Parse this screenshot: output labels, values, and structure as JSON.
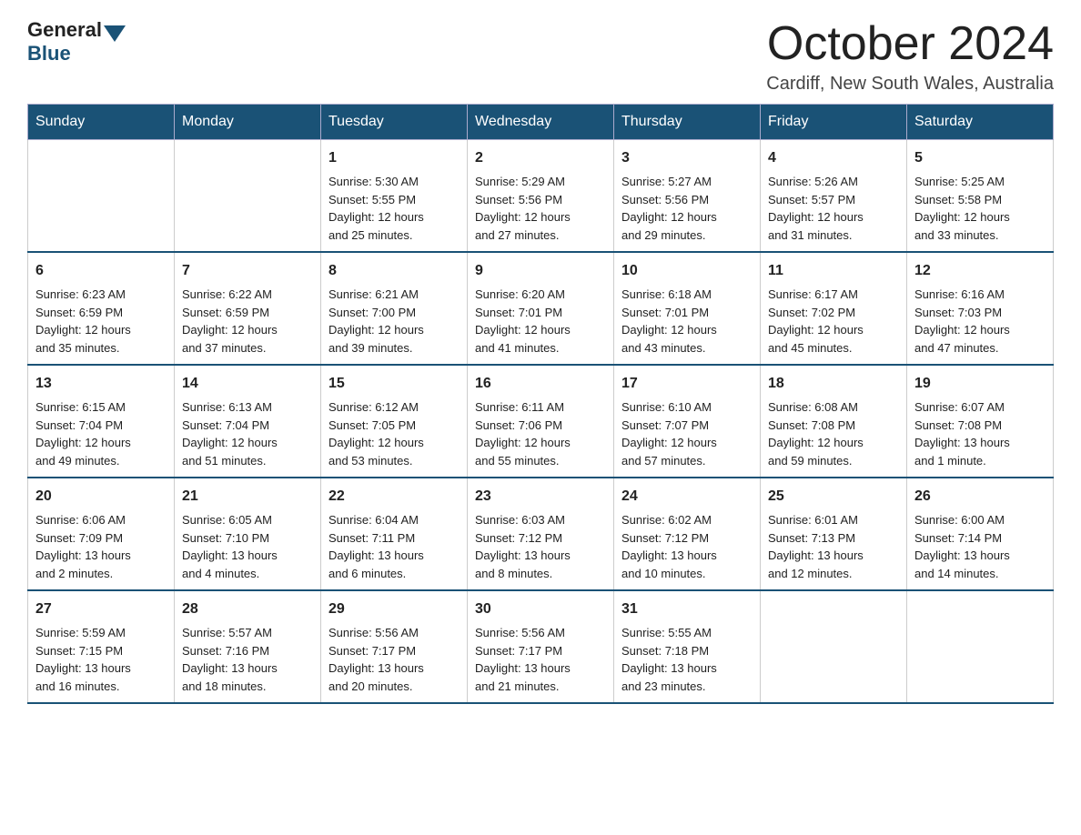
{
  "header": {
    "logo_general": "General",
    "logo_blue": "Blue",
    "month_title": "October 2024",
    "location": "Cardiff, New South Wales, Australia"
  },
  "days_of_week": [
    "Sunday",
    "Monday",
    "Tuesday",
    "Wednesday",
    "Thursday",
    "Friday",
    "Saturday"
  ],
  "weeks": [
    [
      {
        "day": "",
        "info": ""
      },
      {
        "day": "",
        "info": ""
      },
      {
        "day": "1",
        "info": "Sunrise: 5:30 AM\nSunset: 5:55 PM\nDaylight: 12 hours\nand 25 minutes."
      },
      {
        "day": "2",
        "info": "Sunrise: 5:29 AM\nSunset: 5:56 PM\nDaylight: 12 hours\nand 27 minutes."
      },
      {
        "day": "3",
        "info": "Sunrise: 5:27 AM\nSunset: 5:56 PM\nDaylight: 12 hours\nand 29 minutes."
      },
      {
        "day": "4",
        "info": "Sunrise: 5:26 AM\nSunset: 5:57 PM\nDaylight: 12 hours\nand 31 minutes."
      },
      {
        "day": "5",
        "info": "Sunrise: 5:25 AM\nSunset: 5:58 PM\nDaylight: 12 hours\nand 33 minutes."
      }
    ],
    [
      {
        "day": "6",
        "info": "Sunrise: 6:23 AM\nSunset: 6:59 PM\nDaylight: 12 hours\nand 35 minutes."
      },
      {
        "day": "7",
        "info": "Sunrise: 6:22 AM\nSunset: 6:59 PM\nDaylight: 12 hours\nand 37 minutes."
      },
      {
        "day": "8",
        "info": "Sunrise: 6:21 AM\nSunset: 7:00 PM\nDaylight: 12 hours\nand 39 minutes."
      },
      {
        "day": "9",
        "info": "Sunrise: 6:20 AM\nSunset: 7:01 PM\nDaylight: 12 hours\nand 41 minutes."
      },
      {
        "day": "10",
        "info": "Sunrise: 6:18 AM\nSunset: 7:01 PM\nDaylight: 12 hours\nand 43 minutes."
      },
      {
        "day": "11",
        "info": "Sunrise: 6:17 AM\nSunset: 7:02 PM\nDaylight: 12 hours\nand 45 minutes."
      },
      {
        "day": "12",
        "info": "Sunrise: 6:16 AM\nSunset: 7:03 PM\nDaylight: 12 hours\nand 47 minutes."
      }
    ],
    [
      {
        "day": "13",
        "info": "Sunrise: 6:15 AM\nSunset: 7:04 PM\nDaylight: 12 hours\nand 49 minutes."
      },
      {
        "day": "14",
        "info": "Sunrise: 6:13 AM\nSunset: 7:04 PM\nDaylight: 12 hours\nand 51 minutes."
      },
      {
        "day": "15",
        "info": "Sunrise: 6:12 AM\nSunset: 7:05 PM\nDaylight: 12 hours\nand 53 minutes."
      },
      {
        "day": "16",
        "info": "Sunrise: 6:11 AM\nSunset: 7:06 PM\nDaylight: 12 hours\nand 55 minutes."
      },
      {
        "day": "17",
        "info": "Sunrise: 6:10 AM\nSunset: 7:07 PM\nDaylight: 12 hours\nand 57 minutes."
      },
      {
        "day": "18",
        "info": "Sunrise: 6:08 AM\nSunset: 7:08 PM\nDaylight: 12 hours\nand 59 minutes."
      },
      {
        "day": "19",
        "info": "Sunrise: 6:07 AM\nSunset: 7:08 PM\nDaylight: 13 hours\nand 1 minute."
      }
    ],
    [
      {
        "day": "20",
        "info": "Sunrise: 6:06 AM\nSunset: 7:09 PM\nDaylight: 13 hours\nand 2 minutes."
      },
      {
        "day": "21",
        "info": "Sunrise: 6:05 AM\nSunset: 7:10 PM\nDaylight: 13 hours\nand 4 minutes."
      },
      {
        "day": "22",
        "info": "Sunrise: 6:04 AM\nSunset: 7:11 PM\nDaylight: 13 hours\nand 6 minutes."
      },
      {
        "day": "23",
        "info": "Sunrise: 6:03 AM\nSunset: 7:12 PM\nDaylight: 13 hours\nand 8 minutes."
      },
      {
        "day": "24",
        "info": "Sunrise: 6:02 AM\nSunset: 7:12 PM\nDaylight: 13 hours\nand 10 minutes."
      },
      {
        "day": "25",
        "info": "Sunrise: 6:01 AM\nSunset: 7:13 PM\nDaylight: 13 hours\nand 12 minutes."
      },
      {
        "day": "26",
        "info": "Sunrise: 6:00 AM\nSunset: 7:14 PM\nDaylight: 13 hours\nand 14 minutes."
      }
    ],
    [
      {
        "day": "27",
        "info": "Sunrise: 5:59 AM\nSunset: 7:15 PM\nDaylight: 13 hours\nand 16 minutes."
      },
      {
        "day": "28",
        "info": "Sunrise: 5:57 AM\nSunset: 7:16 PM\nDaylight: 13 hours\nand 18 minutes."
      },
      {
        "day": "29",
        "info": "Sunrise: 5:56 AM\nSunset: 7:17 PM\nDaylight: 13 hours\nand 20 minutes."
      },
      {
        "day": "30",
        "info": "Sunrise: 5:56 AM\nSunset: 7:17 PM\nDaylight: 13 hours\nand 21 minutes."
      },
      {
        "day": "31",
        "info": "Sunrise: 5:55 AM\nSunset: 7:18 PM\nDaylight: 13 hours\nand 23 minutes."
      },
      {
        "day": "",
        "info": ""
      },
      {
        "day": "",
        "info": ""
      }
    ]
  ]
}
